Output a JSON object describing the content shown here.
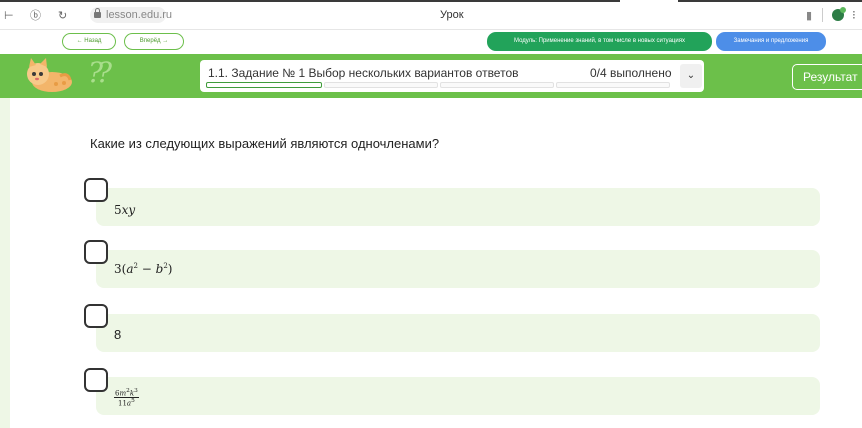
{
  "browser": {
    "url": "lesson.edu.ru",
    "page_title": "Урок"
  },
  "toolbar": {
    "back_label": "← Назад",
    "forward_label": "Вперёд →",
    "module_label": "Модуль: Применение знаний, в том числе в новых ситуациях",
    "remarks_label": "Замечания и предложения"
  },
  "banner": {
    "task_title": "1.1. Задание № 1 Выбор нескольких вариантов ответов",
    "progress": "0/4 выполнено",
    "results_label": "Результат",
    "completed": 0,
    "total": 4
  },
  "question": {
    "text": "Какие из следующих выражений являются одночленами?",
    "options": [
      {
        "label": "5xy"
      },
      {
        "label": "3(a² − b²)"
      },
      {
        "label": "8"
      },
      {
        "label": "6m²k³ / 11a⁵"
      }
    ]
  },
  "colors": {
    "banner_green": "#6cc04a",
    "module_green": "#22a35a",
    "remarks_blue": "#4d8ee8",
    "option_bg": "#eef7e6"
  }
}
